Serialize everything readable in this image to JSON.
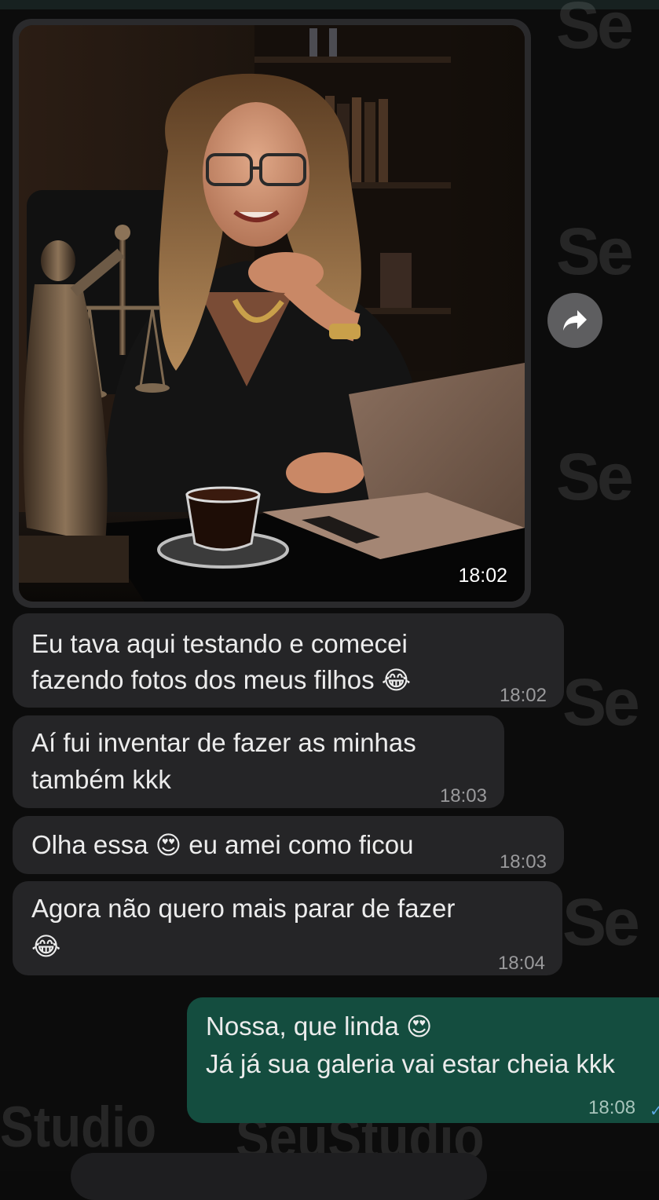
{
  "watermark": {
    "brand_fragment": "Se",
    "studio_left": "Studio",
    "studio_center": "SeuStudio"
  },
  "messages": [
    {
      "type": "image",
      "time": "18:02",
      "description_icon": "forward-icon"
    },
    {
      "type": "text",
      "direction": "in",
      "lines": [
        "Eu tava aqui testando e comecei",
        "fazendo fotos dos meus filhos"
      ],
      "emoji": "😂",
      "time": "18:02"
    },
    {
      "type": "text",
      "direction": "in",
      "lines": [
        "Aí fui inventar de fazer as minhas",
        "também kkk"
      ],
      "time": "18:03"
    },
    {
      "type": "text",
      "direction": "in",
      "before": "Olha essa",
      "emoji": "😍",
      "after": "eu amei como ficou",
      "time": "18:03"
    },
    {
      "type": "text",
      "direction": "in",
      "lines": [
        "Agora não quero mais parar de fazer"
      ],
      "emoji": "😂",
      "time": "18:04"
    },
    {
      "type": "text",
      "direction": "out",
      "line1": "Nossa, que linda",
      "emoji": "😍",
      "line2": "Já já sua galeria vai estar cheia kkk",
      "time": "18:08"
    }
  ],
  "colors": {
    "incoming_bubble": "#252527",
    "outgoing_bubble": "#144d3f",
    "background": "#0c0c0c"
  }
}
